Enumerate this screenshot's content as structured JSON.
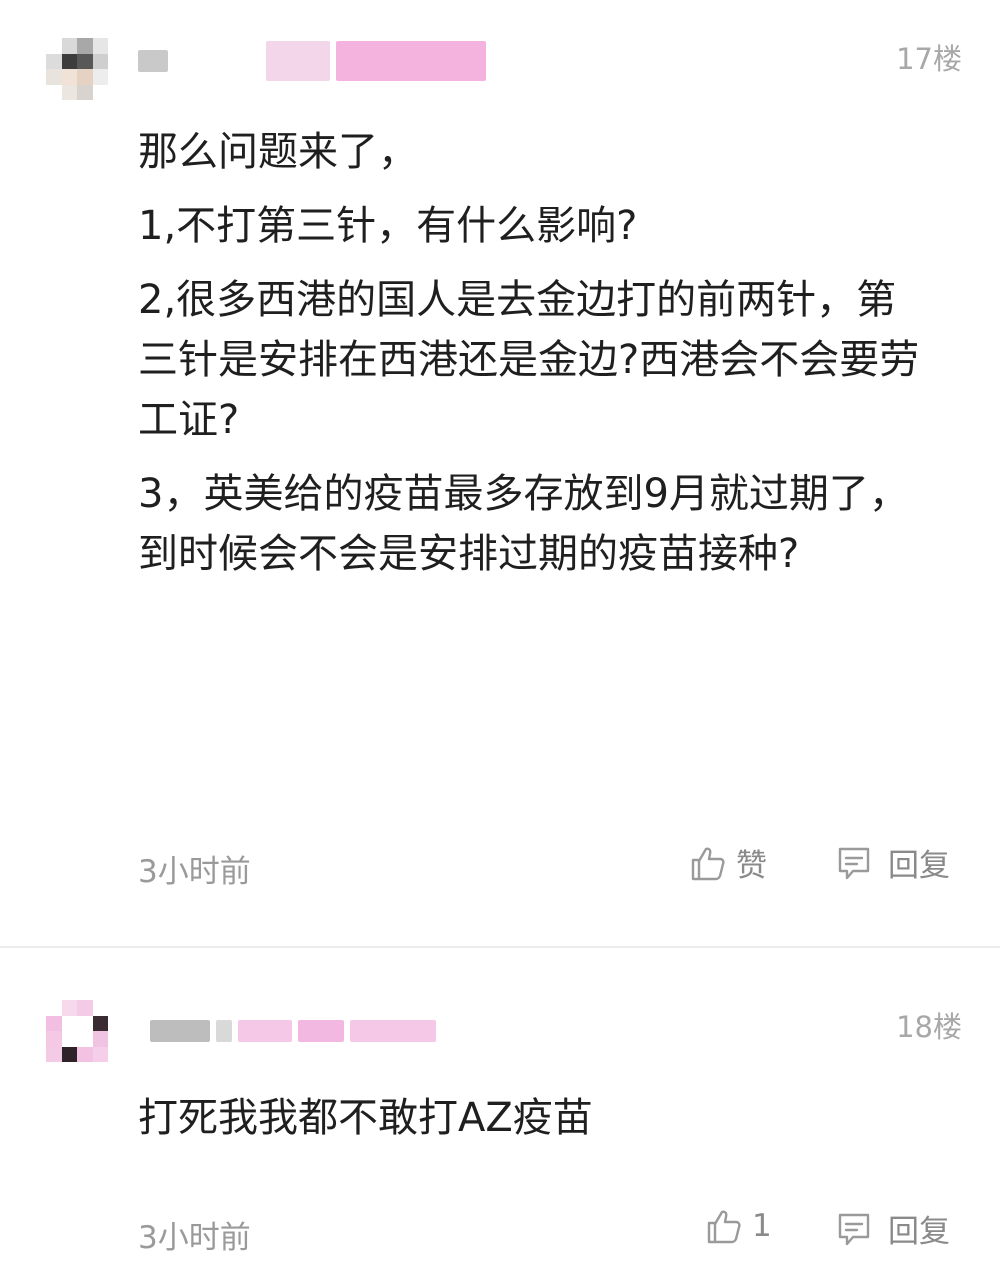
{
  "comments": [
    {
      "floor": "17楼",
      "paragraphs": [
        "那么问题来了，",
        "1,不打第三针，有什么影响?",
        "2,很多西港的国人是去金边打的前两针，第三针是安排在西港还是金边?西港会不会要劳工证?",
        "3，英美给的疫苗最多存放到9月就过期了，到时候会不会是安排过期的疫苗接种?"
      ],
      "time": "3小时前",
      "like_label": "赞",
      "reply_label": "回复",
      "avatar_icon": "pixelated-avatar-icon",
      "username_blocks": [
        "#c9c9c9",
        "#f3d6e9",
        "#f4b3df"
      ]
    },
    {
      "floor": "18楼",
      "paragraphs": [
        "打死我我都不敢打AZ疫苗"
      ],
      "time": "3小时前",
      "like_label": "1",
      "reply_label": "回复",
      "avatar_icon": "pixelated-avatar-icon",
      "username_blocks": [
        "#bdbdbd",
        "#d9d9d9",
        "#f6c8e8",
        "#f3b8e1"
      ]
    }
  ],
  "colors": {
    "text": "#1f1f1f",
    "meta": "#9a9a9a",
    "divider": "#ececec",
    "censor_pink": "#f4b3df"
  }
}
